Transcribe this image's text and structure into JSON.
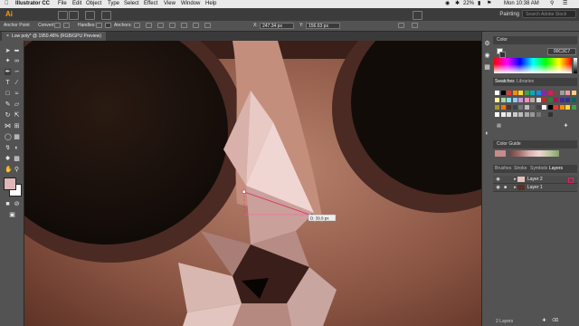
{
  "menubar": {
    "app_name": "Illustrator CC",
    "items": [
      "File",
      "Edit",
      "Object",
      "Type",
      "Select",
      "Effect",
      "View",
      "Window",
      "Help"
    ],
    "battery": "22%",
    "clock": "Mon 10:38 AM"
  },
  "appbar": {
    "logo": "Ai",
    "workspace": "Painting",
    "search_placeholder": "Search Adobe Stock"
  },
  "control_bar": {
    "anchor_point_label": "Anchor Point",
    "convert_label": "Convert:",
    "handles_label": "Handles:",
    "anchors_label": "Anchors:",
    "x_label": "X:",
    "x_value": "247.34 px",
    "y_label": "Y:",
    "y_value": "156.63 px"
  },
  "document": {
    "tab_title": "Low poly* @ 1950.46% (RGB/GPU Preview)"
  },
  "canvas": {
    "measure_tooltip": "D: 39.9 px"
  },
  "color_panel": {
    "title": "Color",
    "hex_value": "00C3C7"
  },
  "swatches_panel": {
    "tab_swatches": "Swatches",
    "tab_libraries": "Libraries"
  },
  "color_guide_panel": {
    "title": "Color Guide"
  },
  "layers_panel": {
    "tabs": [
      "Brushes",
      "Stroke",
      "Symbols",
      "Layers"
    ],
    "layers": [
      "Layer 2",
      "Layer 1"
    ],
    "footer": "2 Layers"
  },
  "colors": {
    "fill": "#dfb7b8",
    "accent_path": "#e0245e",
    "app_bg": "#535353"
  }
}
